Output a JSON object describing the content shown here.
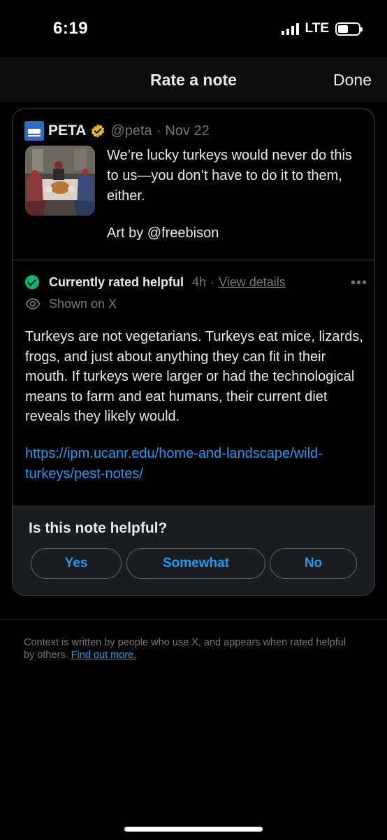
{
  "status_bar": {
    "time": "6:19",
    "network": "LTE",
    "signal_bars": 4,
    "battery_level": 0.4
  },
  "header": {
    "title": "Rate a note",
    "done_label": "Done"
  },
  "tweet": {
    "name": "PETA",
    "verified": true,
    "verified_icon": "gold-verified-badge",
    "handle": "@peta",
    "separator": "·",
    "date": "Nov 22",
    "text": "We’re lucky turkeys would never do this to us—you don’t have to do it to them, either.",
    "art_credit": "Art by @freebison",
    "thumbnail_icon": "artwork-thumbnail"
  },
  "note": {
    "status_label": "Currently rated helpful",
    "time": "4h",
    "separator": "·",
    "view_details_label": "View details",
    "more_icon": "more-horizontal-icon",
    "shown_label": "Shown on X",
    "body": "Turkeys are not vegetarians. Turkeys eat mice, lizards, frogs, and just about anything they can fit in their mouth. If turkeys were larger or had the technological means to farm and eat humans, their current diet reveals they likely would.",
    "link": "https://ipm.ucanr.edu/home-and-landscape/wild-turkeys/pest-notes/"
  },
  "rating": {
    "question": "Is this note helpful?",
    "options": [
      "Yes",
      "Somewhat",
      "No"
    ]
  },
  "footer": {
    "text": "Context is written by people who use X, and appears when rated helpful by others.",
    "link_label": "Find out more."
  },
  "colors": {
    "background": "#000000",
    "accent": "#1d9bf0",
    "helpful_green": "#00ba7c",
    "verified_gold": "#e2b719",
    "muted": "#71767b",
    "panel": "#1a1c1f"
  }
}
